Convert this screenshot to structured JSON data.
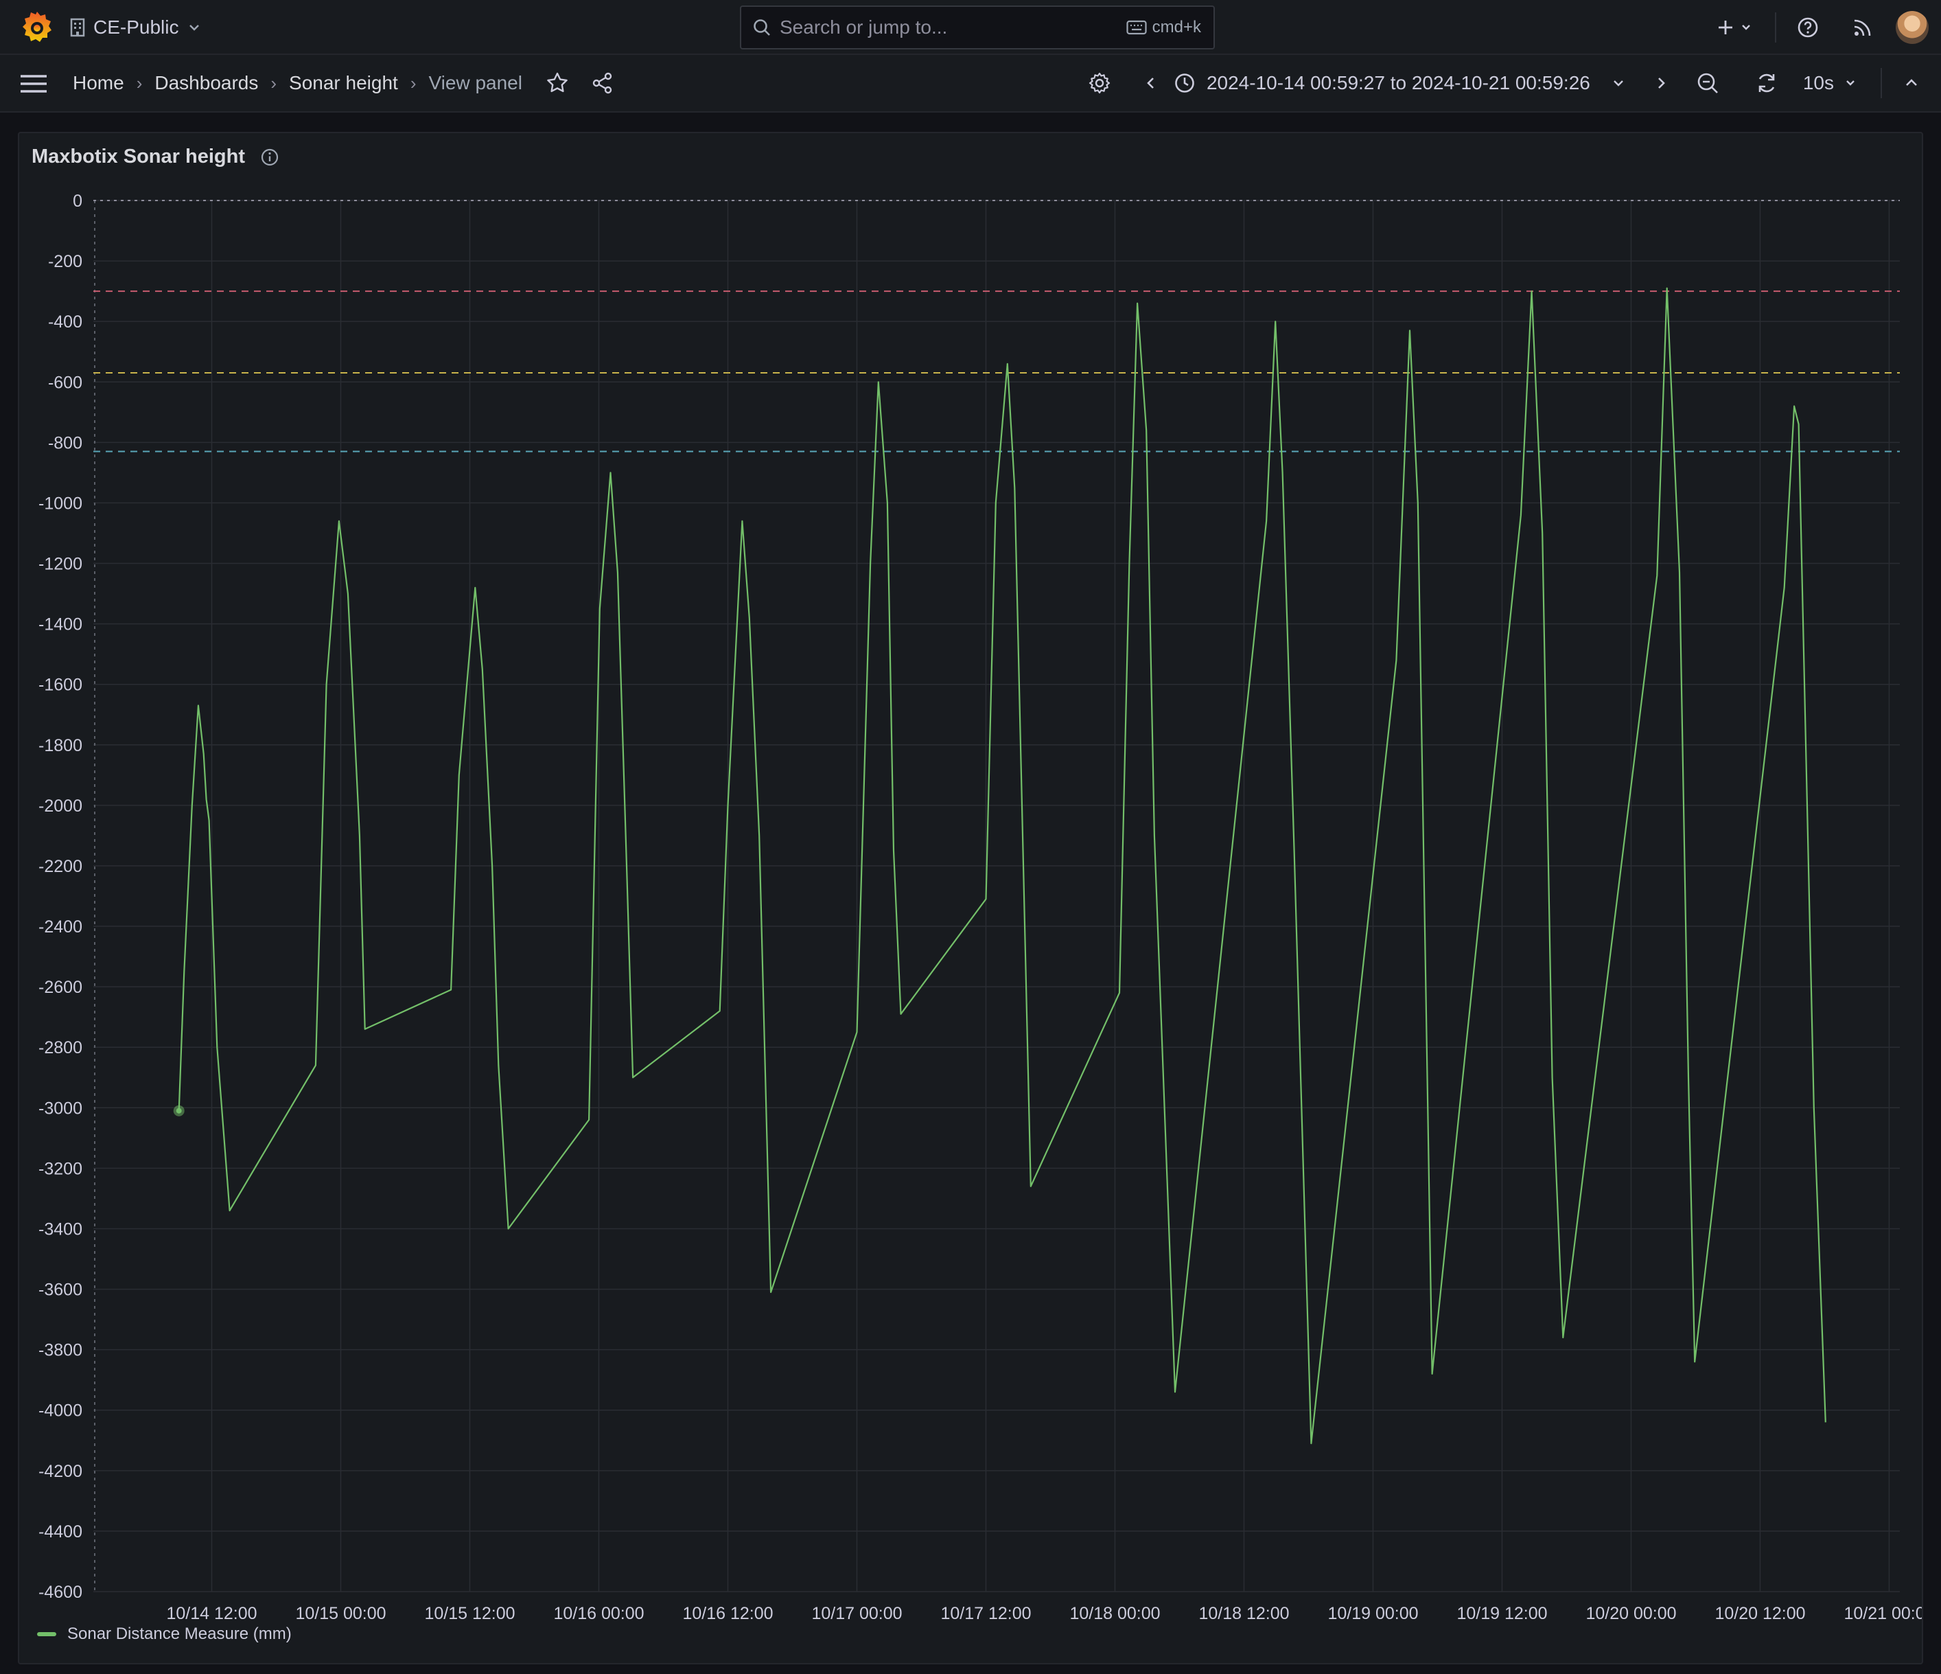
{
  "topbar": {
    "org_name": "CE-Public",
    "search_placeholder": "Search or jump to...",
    "search_shortcut": "cmd+k"
  },
  "breadcrumb": {
    "home": "Home",
    "dashboards": "Dashboards",
    "dashboard": "Sonar height",
    "current": "View panel"
  },
  "time_range": {
    "label": "2024-10-14 00:59:27 to 2024-10-21 00:59:26",
    "refresh_interval": "10s"
  },
  "panel": {
    "title": "Maxbotix Sonar height"
  },
  "colors": {
    "series": "#73bf69",
    "threshold_red": "#c75c6f",
    "threshold_yellow": "#c9b44c",
    "threshold_blue": "#5aa7b8"
  },
  "chart_data": {
    "type": "line",
    "title": "Maxbotix Sonar height",
    "xlabel": "",
    "ylabel": "",
    "ylim": [
      -4600,
      0
    ],
    "yticks": [
      0,
      -200,
      -400,
      -600,
      -800,
      -1000,
      -1200,
      -1400,
      -1600,
      -1800,
      -2000,
      -2200,
      -2400,
      -2600,
      -2800,
      -3000,
      -3200,
      -3400,
      -3600,
      -3800,
      -4000,
      -4200,
      -4400,
      -4600
    ],
    "xlim": [
      "2024-10-14 00:59:27",
      "2024-10-21 00:59:26"
    ],
    "xticks": [
      "2024-10-14 12:00",
      "2024-10-15 00:00",
      "2024-10-15 12:00",
      "2024-10-16 00:00",
      "2024-10-16 12:00",
      "2024-10-17 00:00",
      "2024-10-17 12:00",
      "2024-10-18 00:00",
      "2024-10-18 12:00",
      "2024-10-19 00:00",
      "2024-10-19 12:00",
      "2024-10-20 00:00",
      "2024-10-20 12:00",
      "2024-10-21 00:00"
    ],
    "xtick_labels": [
      "10/14 12:00",
      "10/15 00:00",
      "10/15 12:00",
      "10/16 00:00",
      "10/16 12:00",
      "10/17 00:00",
      "10/17 12:00",
      "10/18 00:00",
      "10/18 12:00",
      "10/19 00:00",
      "10/19 12:00",
      "10/20 00:00",
      "10/20 12:00",
      "10/21 00:00"
    ],
    "thresholds": [
      {
        "value": -300,
        "color": "#c75c6f"
      },
      {
        "value": -570,
        "color": "#c9b44c"
      },
      {
        "value": -830,
        "color": "#5aa7b8"
      }
    ],
    "series": [
      {
        "name": "Sonar Distance Measure (mm)",
        "color": "#73bf69",
        "points": [
          [
            "2024-10-14 08:57",
            -3010
          ],
          [
            "2024-10-14 09:26",
            -2550
          ],
          [
            "2024-10-14 10:10",
            -2000
          ],
          [
            "2024-10-14 10:45",
            -1670
          ],
          [
            "2024-10-14 11:15",
            -1830
          ],
          [
            "2024-10-14 11:30",
            -1980
          ],
          [
            "2024-10-14 11:45",
            -2050
          ],
          [
            "2024-10-14 12:30",
            -2800
          ],
          [
            "2024-10-14 13:40",
            -3340
          ],
          [
            "2024-10-14 21:40",
            -2860
          ],
          [
            "2024-10-14 22:40",
            -1600
          ],
          [
            "2024-10-14 23:50",
            -1060
          ],
          [
            "2024-10-15 00:40",
            -1300
          ],
          [
            "2024-10-15 01:45",
            -2100
          ],
          [
            "2024-10-15 02:15",
            -2740
          ],
          [
            "2024-10-15 10:15",
            -2610
          ],
          [
            "2024-10-15 11:00",
            -1900
          ],
          [
            "2024-10-15 12:30",
            -1280
          ],
          [
            "2024-10-15 13:10",
            -1550
          ],
          [
            "2024-10-15 14:05",
            -2200
          ],
          [
            "2024-10-15 14:40",
            -2860
          ],
          [
            "2024-10-15 15:35",
            -3400
          ],
          [
            "2024-10-15 23:05",
            -3040
          ],
          [
            "2024-10-16 00:05",
            -1350
          ],
          [
            "2024-10-16 01:05",
            -900
          ],
          [
            "2024-10-16 01:45",
            -1230
          ],
          [
            "2024-10-16 02:35",
            -2200
          ],
          [
            "2024-10-16 03:10",
            -2900
          ],
          [
            "2024-10-16 11:15",
            -2680
          ],
          [
            "2024-10-16 12:00",
            -2000
          ],
          [
            "2024-10-16 13:20",
            -1060
          ],
          [
            "2024-10-16 14:00",
            -1380
          ],
          [
            "2024-10-16 14:55",
            -2100
          ],
          [
            "2024-10-16 16:00",
            -3610
          ],
          [
            "2024-10-17 00:00",
            -2750
          ],
          [
            "2024-10-17 01:15",
            -1200
          ],
          [
            "2024-10-17 02:00",
            -600
          ],
          [
            "2024-10-17 02:50",
            -1000
          ],
          [
            "2024-10-17 03:25",
            -2150
          ],
          [
            "2024-10-17 04:05",
            -2690
          ],
          [
            "2024-10-17 12:00",
            -2310
          ],
          [
            "2024-10-17 12:55",
            -1000
          ],
          [
            "2024-10-17 14:00",
            -540
          ],
          [
            "2024-10-17 14:40",
            -950
          ],
          [
            "2024-10-17 16:10",
            -3260
          ],
          [
            "2024-10-18 00:25",
            -2620
          ],
          [
            "2024-10-18 01:20",
            -1200
          ],
          [
            "2024-10-18 02:05",
            -340
          ],
          [
            "2024-10-18 02:55",
            -760
          ],
          [
            "2024-10-18 03:40",
            -2100
          ],
          [
            "2024-10-18 05:35",
            -3940
          ],
          [
            "2024-10-18 14:05",
            -1060
          ],
          [
            "2024-10-18 14:55",
            -400
          ],
          [
            "2024-10-18 15:35",
            -900
          ],
          [
            "2024-10-18 16:40",
            -2150
          ],
          [
            "2024-10-18 18:15",
            -4110
          ],
          [
            "2024-10-19 02:10",
            -1520
          ],
          [
            "2024-10-19 03:25",
            -430
          ],
          [
            "2024-10-19 04:10",
            -1000
          ],
          [
            "2024-10-19 05:30",
            -3880
          ],
          [
            "2024-10-19 13:45",
            -1040
          ],
          [
            "2024-10-19 14:45",
            -300
          ],
          [
            "2024-10-19 15:45",
            -1100
          ],
          [
            "2024-10-19 16:40",
            -2900
          ],
          [
            "2024-10-19 17:40",
            -3760
          ],
          [
            "2024-10-20 02:25",
            -1240
          ],
          [
            "2024-10-20 03:20",
            -290
          ],
          [
            "2024-10-20 04:30",
            -1230
          ],
          [
            "2024-10-20 05:20",
            -2900
          ],
          [
            "2024-10-20 05:55",
            -3840
          ],
          [
            "2024-10-20 14:15",
            -1280
          ],
          [
            "2024-10-20 15:10",
            -680
          ],
          [
            "2024-10-20 15:35",
            -740
          ],
          [
            "2024-10-20 17:00",
            -3000
          ],
          [
            "2024-10-20 18:05",
            -4040
          ]
        ]
      }
    ],
    "legend": "bottom-left",
    "grid": true
  }
}
